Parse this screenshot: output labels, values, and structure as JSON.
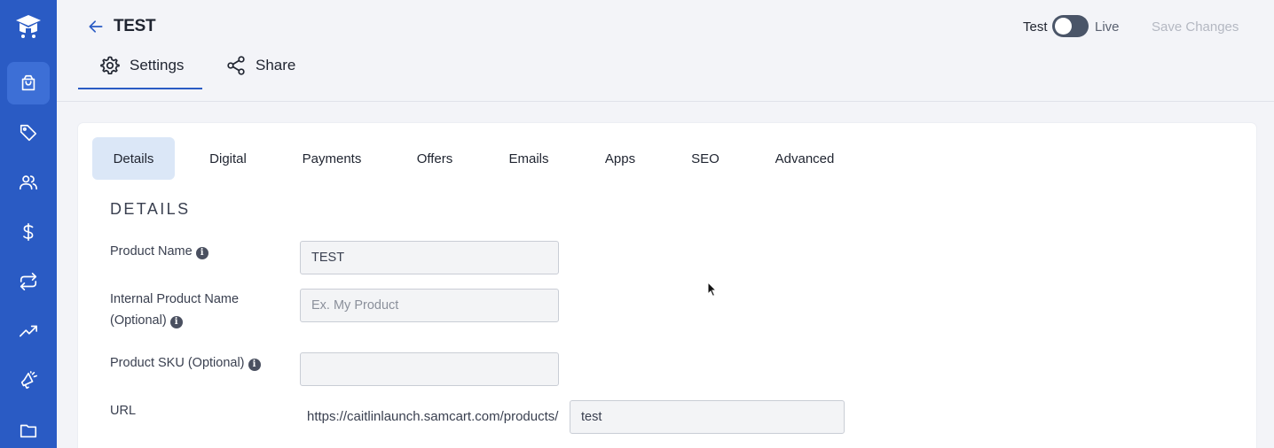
{
  "header": {
    "title": "TEST",
    "mode_test": "Test",
    "mode_live": "Live",
    "save_label": "Save Changes",
    "tabs": [
      {
        "label": "Settings",
        "icon": "gear-icon"
      },
      {
        "label": "Share",
        "icon": "share-icon"
      }
    ]
  },
  "sidebar": {
    "items": [
      {
        "icon": "shopping-bag-icon",
        "active": true
      },
      {
        "icon": "tag-icon"
      },
      {
        "icon": "users-icon"
      },
      {
        "icon": "dollar-icon"
      },
      {
        "icon": "repeat-icon"
      },
      {
        "icon": "trending-up-icon"
      },
      {
        "icon": "megaphone-icon"
      },
      {
        "icon": "folder-icon"
      }
    ]
  },
  "subtabs": [
    "Details",
    "Digital",
    "Payments",
    "Offers",
    "Emails",
    "Apps",
    "SEO",
    "Advanced"
  ],
  "details": {
    "section_title": "DETAILS",
    "product_name_label": "Product Name",
    "product_name_value": "TEST",
    "internal_name_label_1": "Internal Product Name",
    "internal_name_label_2": "(Optional)",
    "internal_name_placeholder": "Ex. My Product",
    "sku_label": "Product SKU (Optional)",
    "sku_value": "",
    "url_label": "URL",
    "url_prefix": "https://caitlinlaunch.samcart.com/products/",
    "url_slug": "test"
  },
  "colors": {
    "sidebar": "#2a5bc4",
    "accent": "#2a5bc4",
    "active_subtab": "#dbe7f7"
  }
}
